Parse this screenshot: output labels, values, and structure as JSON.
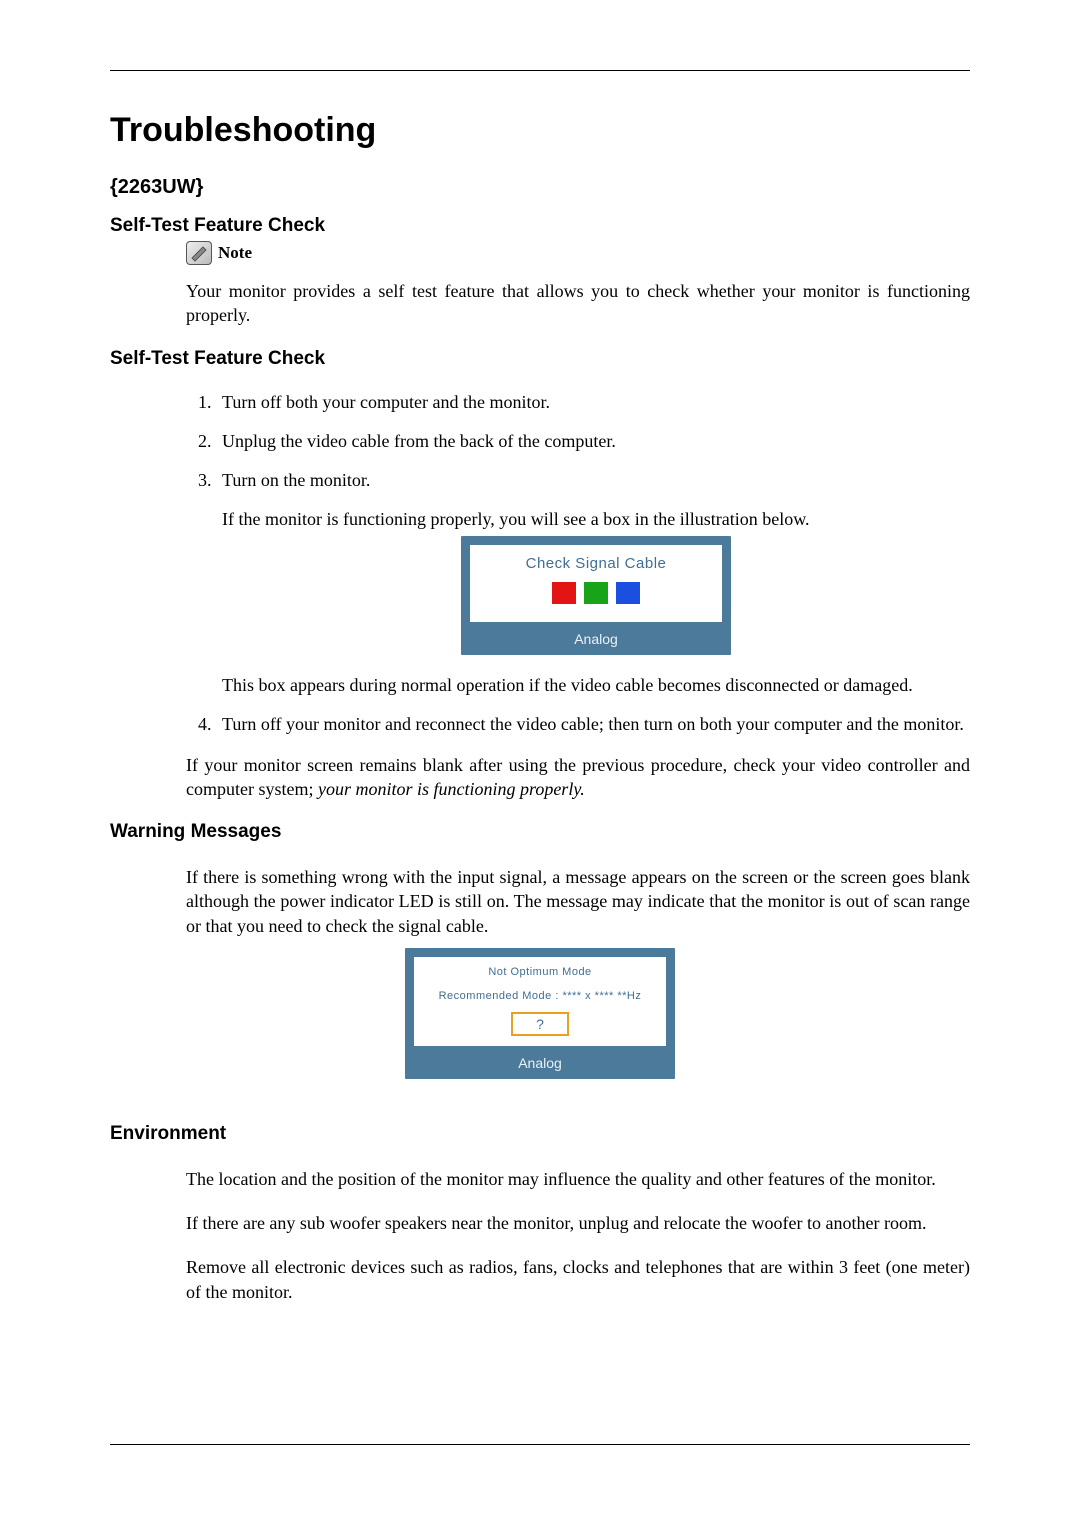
{
  "title": "Troubleshooting",
  "model": "{2263UW}",
  "sections": {
    "selfTest1": {
      "heading": "Self-Test Feature Check",
      "noteLabel": "Note",
      "intro": "Your monitor provides a self test feature that allows you to check whether your monitor is functioning properly."
    },
    "selfTest2": {
      "heading": "Self-Test Feature Check",
      "steps": {
        "s1": "Turn off both your computer and the monitor.",
        "s2": "Unplug the video cable from the back of the computer.",
        "s3": "Turn on the monitor.",
        "s3_sub": "If the monitor is functioning properly, you will see a box in the illustration below.",
        "osd1_top": "Check Signal Cable",
        "osd1_bottom": "Analog",
        "s3_after": "This box appears during normal operation if the video cable becomes disconnected or damaged.",
        "s4": "Turn off your monitor and reconnect the video cable; then turn on both your computer and the monitor."
      },
      "closing_plain": "If your monitor screen remains blank after using the previous procedure, check your video controller and computer system; ",
      "closing_italic": "your monitor is functioning properly."
    },
    "warning": {
      "heading": "Warning Messages",
      "para": "If there is something wrong with the input signal, a message appears on the screen or the screen goes blank although the power indicator LED is still on. The message may indicate that the monitor is out of scan range or that you need to check the signal cable.",
      "osd2_line1": "Not Optimum Mode",
      "osd2_line2": "Recommended Mode : **** x ****  **Hz",
      "osd2_q": "?",
      "osd2_bottom": "Analog"
    },
    "environment": {
      "heading": "Environment",
      "p1": "The location and the position of the monitor may influence the quality and other features of the monitor.",
      "p2": "If there are any sub woofer speakers near the monitor, unplug and relocate the woofer to another room.",
      "p3": "Remove all electronic devices such as radios, fans, clocks and telephones that are within 3 feet (one meter) of the monitor."
    }
  }
}
